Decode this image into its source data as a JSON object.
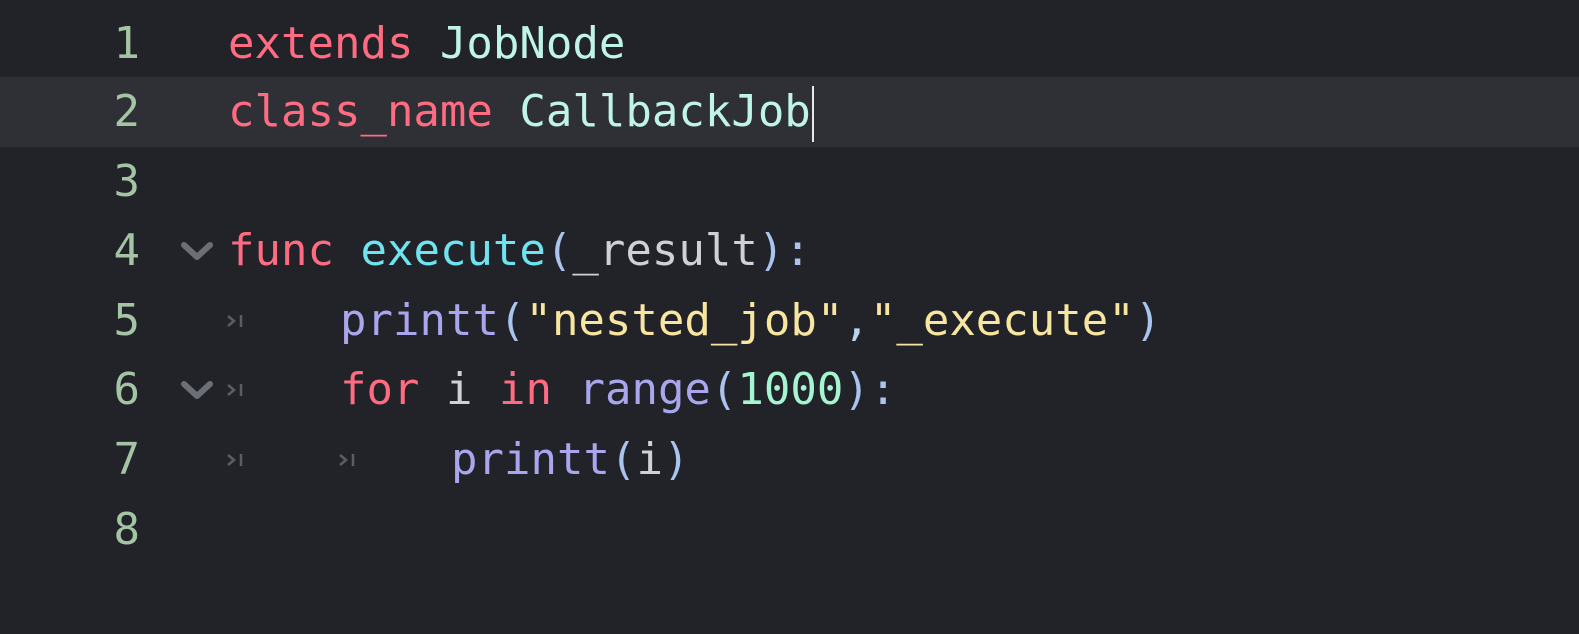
{
  "editor": {
    "current_line": 2,
    "colors": {
      "background": "#212328",
      "current_line": "#2e3036",
      "line_number": "#a4c4a4",
      "keyword": "#ff6b81",
      "type": "#bff4e6",
      "function": "#6ee4f0",
      "builtin": "#a9a6ee",
      "string": "#f8e6a0",
      "number": "#a6f5d2"
    },
    "lines": [
      {
        "number": "1",
        "tokens": [
          "extends",
          " ",
          "JobNode"
        ]
      },
      {
        "number": "2",
        "tokens": [
          "class_name",
          " ",
          "CallbackJob"
        ]
      },
      {
        "number": "3",
        "tokens": []
      },
      {
        "number": "4",
        "fold": "chevron-down-icon",
        "tokens": [
          "func",
          " ",
          "execute",
          "(",
          "_result",
          "):"
        ]
      },
      {
        "number": "5",
        "indent": 1,
        "tokens": [
          "printt",
          "(",
          "\"nested_job\"",
          ",",
          "\"_execute\"",
          ")"
        ]
      },
      {
        "number": "6",
        "indent": 1,
        "fold": "chevron-down-icon",
        "tokens": [
          "for",
          " ",
          "i",
          " ",
          "in",
          " ",
          "range",
          "(",
          "1000",
          "):"
        ]
      },
      {
        "number": "7",
        "indent": 2,
        "tokens": [
          "printt",
          "(",
          "i",
          ")"
        ]
      },
      {
        "number": "8",
        "tokens": []
      }
    ]
  }
}
